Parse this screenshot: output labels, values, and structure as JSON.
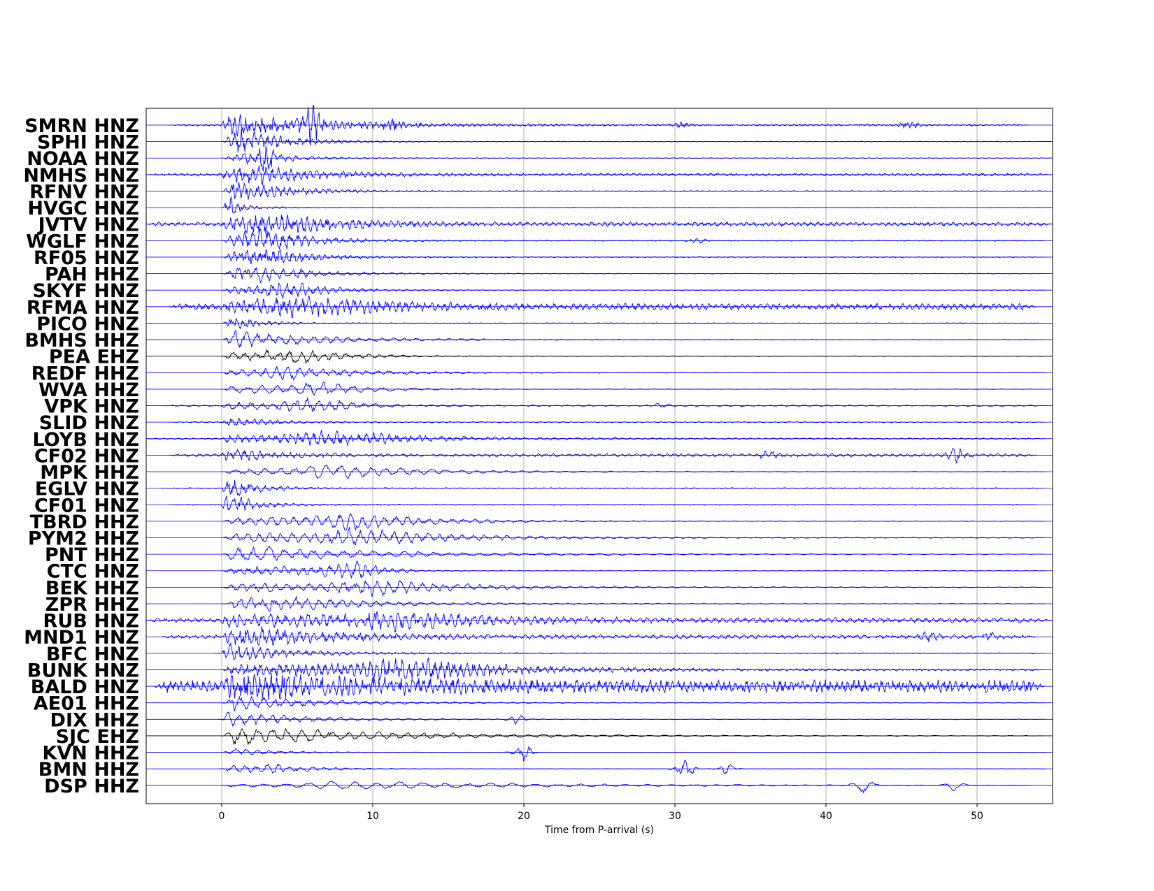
{
  "chart_data": {
    "type": "line",
    "xlabel": "Time from P-arrival (s)",
    "xlim": [
      -5,
      55
    ],
    "xticks": [
      0,
      10,
      20,
      30,
      40,
      50
    ],
    "grid": true,
    "colors": {
      "blue": "#0000ff",
      "black": "#000000",
      "frame": "#000000",
      "grid": "#b0b0b0"
    },
    "series": [
      {
        "name": "SMRN HNZ",
        "color": "#0000ff",
        "start": -3.5,
        "end": 53.5,
        "amp": 0.55,
        "noise": 0.05,
        "peak_t": 1.5,
        "decay": 6,
        "osc": 8,
        "bursts": [
          [
            6.0,
            0.9
          ],
          [
            11.3,
            0.25
          ],
          [
            30.6,
            0.15
          ],
          [
            45.5,
            0.2
          ]
        ]
      },
      {
        "name": "SPHI HNZ",
        "color": "#0000ff",
        "start": 0,
        "end": 55,
        "amp": 0.7,
        "noise": 0.02,
        "peak_t": 1.5,
        "decay": 3,
        "osc": 7,
        "bursts": []
      },
      {
        "name": "NOAA HNZ",
        "color": "#0000ff",
        "start": 0,
        "end": 55,
        "amp": 0.35,
        "noise": 0.02,
        "peak_t": 2.8,
        "decay": 2.5,
        "osc": 6,
        "bursts": [
          [
            3.0,
            0.7
          ]
        ]
      },
      {
        "name": "NMHS HNZ",
        "color": "#0000ff",
        "start": -5,
        "end": 55,
        "amp": 0.5,
        "noise": 0.08,
        "peak_t": 2.5,
        "decay": 4,
        "osc": 7,
        "bursts": []
      },
      {
        "name": "RFNV HNZ",
        "color": "#0000ff",
        "start": 0,
        "end": 55,
        "amp": 0.6,
        "noise": 0.03,
        "peak_t": 1.5,
        "decay": 3.5,
        "osc": 7,
        "bursts": []
      },
      {
        "name": "HVGC HNZ",
        "color": "#0000ff",
        "start": 0,
        "end": 55,
        "amp": 0.35,
        "noise": 0.02,
        "peak_t": 0.3,
        "decay": 1.5,
        "osc": 7,
        "bursts": [
          [
            0.2,
            0.8
          ]
        ]
      },
      {
        "name": "JVTV HNZ",
        "color": "#0000ff",
        "start": -5,
        "end": 55,
        "amp": 0.6,
        "noise": 0.12,
        "peak_t": 3.5,
        "decay": 4,
        "osc": 7,
        "bursts": []
      },
      {
        "name": "WGLF HNZ",
        "color": "#0000ff",
        "start": 0,
        "end": 54.5,
        "amp": 0.7,
        "noise": 0.03,
        "peak_t": 3.3,
        "decay": 3,
        "osc": 6,
        "bursts": [
          [
            31.5,
            0.15
          ]
        ]
      },
      {
        "name": "RF05 HNZ",
        "color": "#0000ff",
        "start": 0,
        "end": 54.5,
        "amp": 0.55,
        "noise": 0.03,
        "peak_t": 3.0,
        "decay": 3,
        "osc": 7,
        "bursts": []
      },
      {
        "name": "PAH HHZ",
        "color": "#0000ff",
        "start": 0,
        "end": 54.5,
        "amp": 0.55,
        "noise": 0.02,
        "peak_t": 2.5,
        "decay": 4,
        "osc": 5,
        "bursts": []
      },
      {
        "name": "SKYF HNZ",
        "color": "#0000ff",
        "start": 0,
        "end": 54.5,
        "amp": 0.5,
        "noise": 0.02,
        "peak_t": 4.5,
        "decay": 3,
        "osc": 6,
        "bursts": []
      },
      {
        "name": "RFMA HNZ",
        "color": "#0000ff",
        "start": -3.5,
        "end": 54,
        "amp": 0.55,
        "noise": 0.18,
        "peak_t": 5.5,
        "decay": 5,
        "osc": 7,
        "bursts": []
      },
      {
        "name": "PICO HNZ",
        "color": "#0000ff",
        "start": 0,
        "end": 54.5,
        "amp": 0.45,
        "noise": 0.02,
        "peak_t": 0.5,
        "decay": 2,
        "osc": 7,
        "bursts": []
      },
      {
        "name": "BMHS HHZ",
        "color": "#0000ff",
        "start": 0,
        "end": 54.5,
        "amp": 0.6,
        "noise": 0.02,
        "peak_t": 1.0,
        "decay": 6,
        "osc": 4,
        "bursts": []
      },
      {
        "name": "PEA EHZ",
        "color": "#000000",
        "start": 0,
        "end": 55,
        "amp": 0.6,
        "noise": 0.02,
        "peak_t": 5.0,
        "decay": 3,
        "osc": 4,
        "bursts": []
      },
      {
        "name": "REDF HHZ",
        "color": "#0000ff",
        "start": 0,
        "end": 54.5,
        "amp": 0.5,
        "noise": 0.02,
        "peak_t": 4.5,
        "decay": 5,
        "osc": 4,
        "bursts": []
      },
      {
        "name": "WVA HHZ",
        "color": "#0000ff",
        "start": 0,
        "end": 54.5,
        "amp": 0.6,
        "noise": 0.02,
        "peak_t": 6.5,
        "decay": 3,
        "osc": 3,
        "bursts": []
      },
      {
        "name": "VPK HNZ",
        "color": "#0000ff",
        "start": -4,
        "end": 54.5,
        "amp": 0.55,
        "noise": 0.05,
        "peak_t": 6.5,
        "decay": 2.5,
        "osc": 4,
        "bursts": [
          [
            29.2,
            0.15
          ]
        ]
      },
      {
        "name": "SLID HNZ",
        "color": "#0000ff",
        "start": -3.5,
        "end": 54.5,
        "amp": 0.35,
        "noise": 0.03,
        "peak_t": 0.3,
        "decay": 3,
        "osc": 6,
        "bursts": []
      },
      {
        "name": "LOYB HNZ",
        "color": "#0000ff",
        "start": -5,
        "end": 54.5,
        "amp": 0.5,
        "noise": 0.05,
        "peak_t": 7.0,
        "decay": 6,
        "osc": 6,
        "bursts": []
      },
      {
        "name": "CF02 HNZ",
        "color": "#0000ff",
        "start": -3.5,
        "end": 54,
        "amp": 0.35,
        "noise": 0.1,
        "peak_t": 0.5,
        "decay": 3,
        "osc": 6,
        "bursts": [
          [
            36.2,
            0.25
          ],
          [
            48.7,
            0.4
          ]
        ]
      },
      {
        "name": "MPK HHZ",
        "color": "#0000ff",
        "start": 0,
        "end": 54.5,
        "amp": 0.5,
        "noise": 0.02,
        "peak_t": 7.5,
        "decay": 6,
        "osc": 3,
        "bursts": []
      },
      {
        "name": "EGLV HNZ",
        "color": "#0000ff",
        "start": -4,
        "end": 54.5,
        "amp": 0.6,
        "noise": 0.03,
        "peak_t": 0.7,
        "decay": 2,
        "osc": 6,
        "bursts": []
      },
      {
        "name": "CF01 HNZ",
        "color": "#0000ff",
        "start": -3.5,
        "end": 54,
        "amp": 0.6,
        "noise": 0.03,
        "peak_t": 0.5,
        "decay": 2,
        "osc": 6,
        "bursts": []
      },
      {
        "name": "TBRD HHZ",
        "color": "#0000ff",
        "start": 0,
        "end": 54.5,
        "amp": 0.6,
        "noise": 0.02,
        "peak_t": 9.0,
        "decay": 5,
        "osc": 4,
        "bursts": []
      },
      {
        "name": "PYM2 HHZ",
        "color": "#0000ff",
        "start": 0,
        "end": 54.5,
        "amp": 0.65,
        "noise": 0.03,
        "peak_t": 9.0,
        "decay": 6,
        "osc": 4,
        "bursts": []
      },
      {
        "name": "PNT HHZ",
        "color": "#0000ff",
        "start": 0,
        "end": 54.5,
        "amp": 0.6,
        "noise": 0.02,
        "peak_t": 1.2,
        "decay": 10,
        "osc": 3,
        "bursts": []
      },
      {
        "name": "CTC HNZ",
        "color": "#0000ff",
        "start": 0,
        "end": 54.5,
        "amp": 0.55,
        "noise": 0.02,
        "peak_t": 9.0,
        "decay": 2,
        "osc": 5,
        "bursts": []
      },
      {
        "name": "BEK HHZ",
        "color": "#0000ff",
        "start": 0,
        "end": 54.5,
        "amp": 0.6,
        "noise": 0.03,
        "peak_t": 10.0,
        "decay": 6,
        "osc": 4,
        "bursts": []
      },
      {
        "name": "ZPR HHZ",
        "color": "#0000ff",
        "start": 0,
        "end": 54.5,
        "amp": 0.55,
        "noise": 0.02,
        "peak_t": 3.0,
        "decay": 7,
        "osc": 4,
        "bursts": []
      },
      {
        "name": "RUB HNZ",
        "color": "#0000ff",
        "start": -5,
        "end": 55,
        "amp": 0.6,
        "noise": 0.15,
        "peak_t": 11.0,
        "decay": 6,
        "osc": 6,
        "bursts": []
      },
      {
        "name": "MND1 HNZ",
        "color": "#0000ff",
        "start": -4,
        "end": 54,
        "amp": 0.55,
        "noise": 0.12,
        "peak_t": 2.5,
        "decay": 6,
        "osc": 6,
        "bursts": [
          [
            46.8,
            0.3
          ],
          [
            51.0,
            0.2
          ]
        ]
      },
      {
        "name": "BFC HNZ",
        "color": "#0000ff",
        "start": -0.5,
        "end": 54.5,
        "amp": 0.6,
        "noise": 0.03,
        "peak_t": 0.5,
        "decay": 4,
        "osc": 6,
        "bursts": []
      },
      {
        "name": "BUNK HNZ",
        "color": "#0000ff",
        "start": 0,
        "end": 54.5,
        "amp": 0.75,
        "noise": 0.05,
        "peak_t": 12.0,
        "decay": 7,
        "osc": 7,
        "bursts": []
      },
      {
        "name": "BALD HNZ",
        "color": "#0000ff",
        "start": -4.5,
        "end": 54.5,
        "amp": 0.5,
        "noise": 0.35,
        "peak_t": 2.5,
        "decay": 8,
        "osc": 8,
        "bursts": []
      },
      {
        "name": "AE01 HHZ",
        "color": "#0000ff",
        "start": 0,
        "end": 54.5,
        "amp": 0.55,
        "noise": 0.02,
        "peak_t": 0.7,
        "decay": 6,
        "osc": 4,
        "bursts": []
      },
      {
        "name": "DIX HHZ",
        "color": "#0000ff",
        "start": -0.3,
        "end": 54.5,
        "amp": 0.55,
        "noise": 0.02,
        "peak_t": 0.6,
        "decay": 5,
        "osc": 4,
        "bursts": [
          [
            19.5,
            0.3
          ]
        ]
      },
      {
        "name": "SJC EHZ",
        "color": "#000000",
        "start": 0,
        "end": 54.5,
        "amp": 0.7,
        "noise": 0.02,
        "peak_t": 0.8,
        "decay": 10,
        "osc": 3,
        "bursts": []
      },
      {
        "name": "KVN HHZ",
        "color": "#0000ff",
        "start": 0,
        "end": 54.5,
        "amp": 0.3,
        "noise": 0.01,
        "peak_t": 0.5,
        "decay": 3,
        "osc": 4,
        "bursts": [
          [
            20.0,
            0.8
          ]
        ]
      },
      {
        "name": "BMN HHZ",
        "color": "#0000ff",
        "start": -0.2,
        "end": 54.5,
        "amp": 0.35,
        "noise": 0.01,
        "peak_t": 3.2,
        "decay": 3,
        "osc": 4,
        "bursts": [
          [
            30.7,
            0.8
          ],
          [
            33.5,
            0.4
          ]
        ]
      },
      {
        "name": "DSP HHZ",
        "color": "#0000ff",
        "start": 0,
        "end": 53.5,
        "amp": 0.35,
        "noise": 0.01,
        "peak_t": 8.0,
        "decay": 15,
        "osc": 2,
        "bursts": [
          [
            42.5,
            0.9
          ],
          [
            48.5,
            0.4
          ]
        ]
      }
    ]
  }
}
